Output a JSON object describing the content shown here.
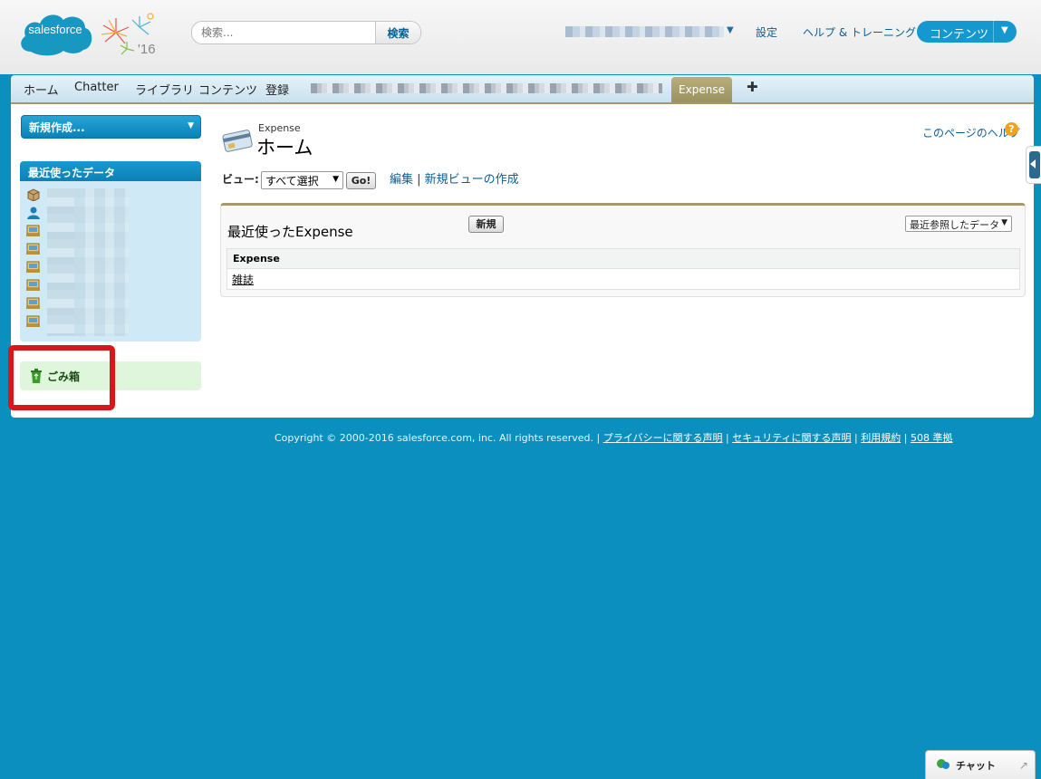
{
  "header": {
    "logo_text": "salesforce",
    "logo_year": "'16",
    "search_placeholder": "検索...",
    "search_button": "検索",
    "links": [
      "設定",
      "ヘルプ & トレーニング"
    ],
    "app_menu_label": "コンテンツ"
  },
  "tabs": {
    "items": [
      "ホーム",
      "Chatter",
      "ライブラリ",
      "コンテンツ",
      "登録"
    ],
    "active": "Expense",
    "add_icon": "plus-icon"
  },
  "sidebar": {
    "new_button": "新規作成...",
    "recent_title": "最近使ったデータ",
    "recent_icons": [
      "package-icon",
      "user-icon",
      "custom-object-icon",
      "custom-object-icon",
      "custom-object-icon",
      "custom-object-icon",
      "custom-object-icon",
      "custom-object-icon"
    ],
    "trash_label": "ごみ箱"
  },
  "main": {
    "object_label": "Expense",
    "page_title": "ホーム",
    "help_link": "このページのヘルプ",
    "view_label": "ビュー:",
    "view_selected": "すべて選択",
    "go_button": "Go!",
    "edit_link": "編集",
    "new_view_link": "新規ビューの作成",
    "recent_section": {
      "title": "最近使ったExpense",
      "new_button": "新規",
      "sort_selected": "最近参照したデータ",
      "column_header": "Expense",
      "rows": [
        "雑誌"
      ]
    }
  },
  "footer": {
    "copyright": "Copyright © 2000-2016 salesforce.com, inc. All rights reserved.",
    "links": [
      "プライバシーに関する声明",
      "セキュリティに関する声明",
      "利用規約",
      "508 準拠"
    ]
  },
  "chat": {
    "label": "チャット"
  },
  "colors": {
    "background": "#0a8fbf",
    "accent_blue": "#1598cf",
    "tab_active": "#a39a68",
    "highlight": "#d81818"
  }
}
